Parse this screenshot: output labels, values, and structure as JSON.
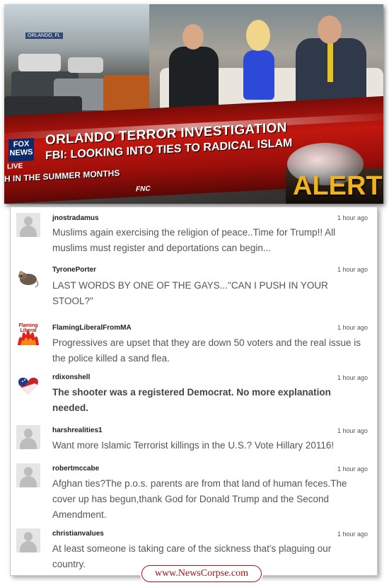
{
  "tv": {
    "network": "FOX NEWS",
    "live_label": "LIVE",
    "location_tag": "ORLANDO, FL",
    "headline": "ORLANDO TERROR INVESTIGATION",
    "subheadline": "FBI: LOOKING INTO TIES TO RADICAL ISLAM",
    "ticker": "H IN THE SUMMER MONTHS",
    "channel_bug": "FNC",
    "alert": "ALERT"
  },
  "comments": [
    {
      "user": "jnostradamus",
      "time": "1 hour ago",
      "avatar": "default-avatar-icon",
      "text": "Muslims again exercising the religion of peace..Time for Trump!!  All muslims must register and deportations can begin...",
      "bold": false
    },
    {
      "user": "TyronePorter",
      "time": "1 hour ago",
      "avatar": "rat-avatar-icon",
      "text": "LAST WORDS BY ONE OF THE GAYS...\"CAN I PUSH IN YOUR STOOL?\"",
      "bold": false
    },
    {
      "user": "FlamingLiberalFromMA",
      "time": "1 hour ago",
      "avatar": "flaming-liberal-avatar-icon",
      "text": "Progressives are upset that they are down 50 voters and the real issue is the police killed a sand flea.",
      "bold": false
    },
    {
      "user": "rdixonshell",
      "time": "1 hour ago",
      "avatar": "flag-heart-avatar-icon",
      "text": " The shooter was a registered Democrat.  No more explanation needed.",
      "bold": true
    },
    {
      "user": "harshrealities1",
      "time": "1 hour ago",
      "avatar": "default-avatar-icon",
      "text": "Want more Islamic Terrorist killings in the U.S.? Vote Hillary 20116!",
      "bold": false
    },
    {
      "user": "robertmccabe",
      "time": "1 hour ago",
      "avatar": "default-avatar-icon",
      "text": "Afghan ties?The p.o.s. parents are from that land of human feces.The cover up has begun,thank God for Donald Trump and the Second Amendment.",
      "bold": false
    },
    {
      "user": "christianvalues",
      "time": "1 hour ago",
      "avatar": "default-avatar-icon",
      "text": "At least someone is taking care of the sickness that's plaguing our country.",
      "bold": false
    }
  ],
  "flaming_avatar_text": "Flaming Liberal",
  "watermark": "www.NewsCorpse.com"
}
